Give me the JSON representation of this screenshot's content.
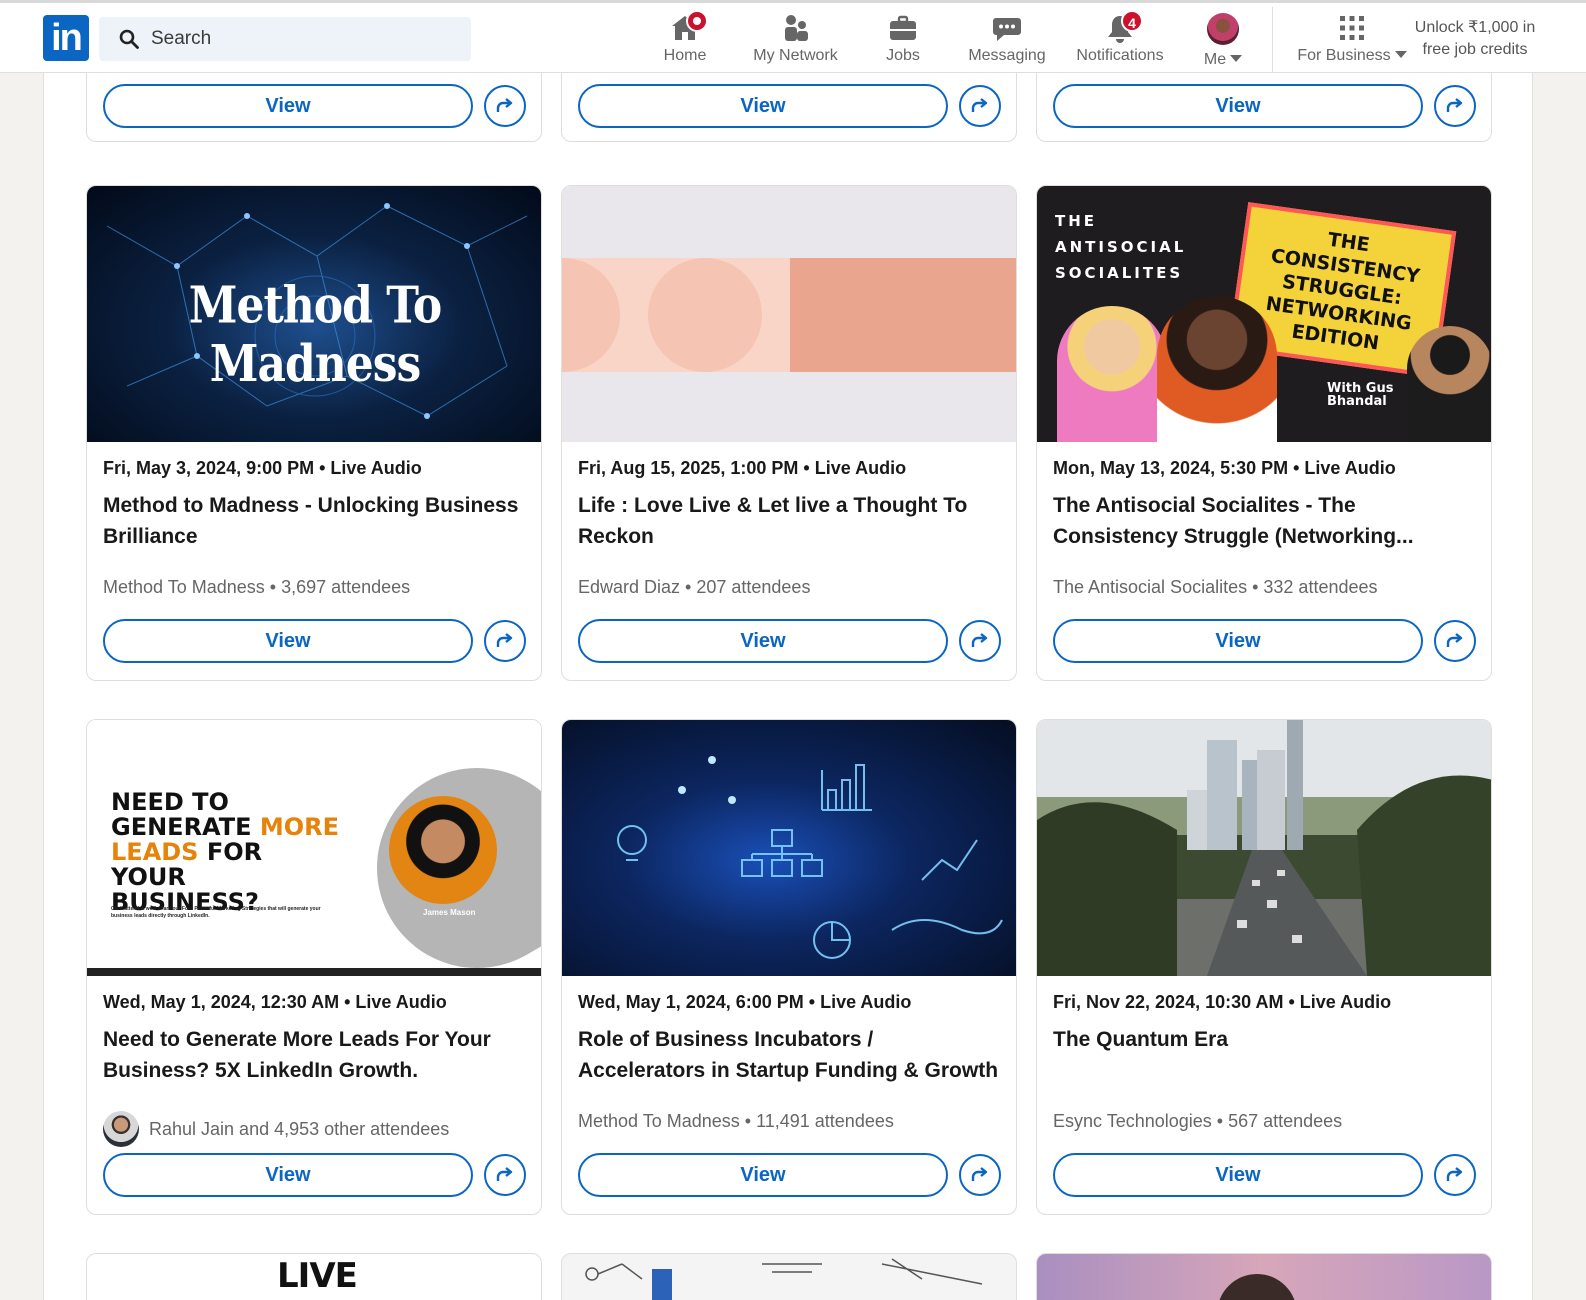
{
  "nav": {
    "logo": "in",
    "search_placeholder": "Search",
    "items": [
      {
        "label": "Home",
        "icon": "home-icon",
        "badge": ""
      },
      {
        "label": "My Network",
        "icon": "network-icon",
        "badge": ""
      },
      {
        "label": "Jobs",
        "icon": "briefcase-icon",
        "badge": ""
      },
      {
        "label": "Messaging",
        "icon": "chat-icon",
        "badge": ""
      },
      {
        "label": "Notifications",
        "icon": "bell-icon",
        "badge": "4"
      },
      {
        "label": "Me",
        "icon": "avatar",
        "badge": ""
      },
      {
        "label": "For Business",
        "icon": "grid-icon",
        "badge": ""
      }
    ],
    "unlock_line1": "Unlock ₹1,000 in",
    "unlock_line2": "free job credits"
  },
  "buttons": {
    "view": "View"
  },
  "events": [
    {
      "banner_text": "Method To Madness",
      "meta": "Fri, May 3, 2024, 9:00 PM  •  Live Audio",
      "title": "Method to Madness - Unlocking Business Brilliance",
      "sub": "Method To Madness • 3,697 attendees"
    },
    {
      "banner_text": "",
      "meta": "Fri, Aug 15, 2025, 1:00 PM  •  Live Audio",
      "title": "Life : Love Live & Let live a Thought To Reckon",
      "sub": "Edward Diaz • 207 attendees"
    },
    {
      "banner_text": "THE ANTISOCIAL SOCIALITES",
      "banner_text2": "THE CONSISTENCY STRUGGLE: NETWORKING EDITION",
      "banner_text3": "With Gus Bhandal",
      "meta": "Mon, May 13, 2024, 5:30 PM  •  Live Audio",
      "title": "The Antisocial Socialites - The Consistency Struggle (Networking...",
      "sub": "The Antisocial Socialites • 332 attendees"
    },
    {
      "banner_text": "NEED TO GENERATE",
      "banner_highlight": "MORE LEADS",
      "banner_text_b": "FOR YOUR BUSINESS?",
      "banner_small": "Click attend & we'll share our Four Powerful Marketing Strategies that will generate your business leads directly through LinkedIn.",
      "banner_name": "James Mason",
      "meta": "Wed, May 1, 2024, 12:30 AM  •  Live Audio",
      "title": "Need to Generate More Leads For Your Business? 5X LinkedIn Growth.",
      "sub": "Rahul Jain and 4,953 other attendees"
    },
    {
      "banner_text": "",
      "meta": "Wed, May 1, 2024, 6:00 PM  •  Live Audio",
      "title": "Role of Business Incubators / Accelerators in Startup Funding & Growth",
      "sub": "Method To Madness • 11,491 attendees"
    },
    {
      "banner_text": "",
      "meta": "Fri, Nov 22, 2024, 10:30 AM  •  Live Audio",
      "title": "The Quantum Era",
      "sub": "Esync Technologies • 567 attendees"
    }
  ],
  "bottom_partial_text": "LIVE",
  "colors": {
    "brand": "#0a66c2",
    "badge": "#cb112d"
  }
}
